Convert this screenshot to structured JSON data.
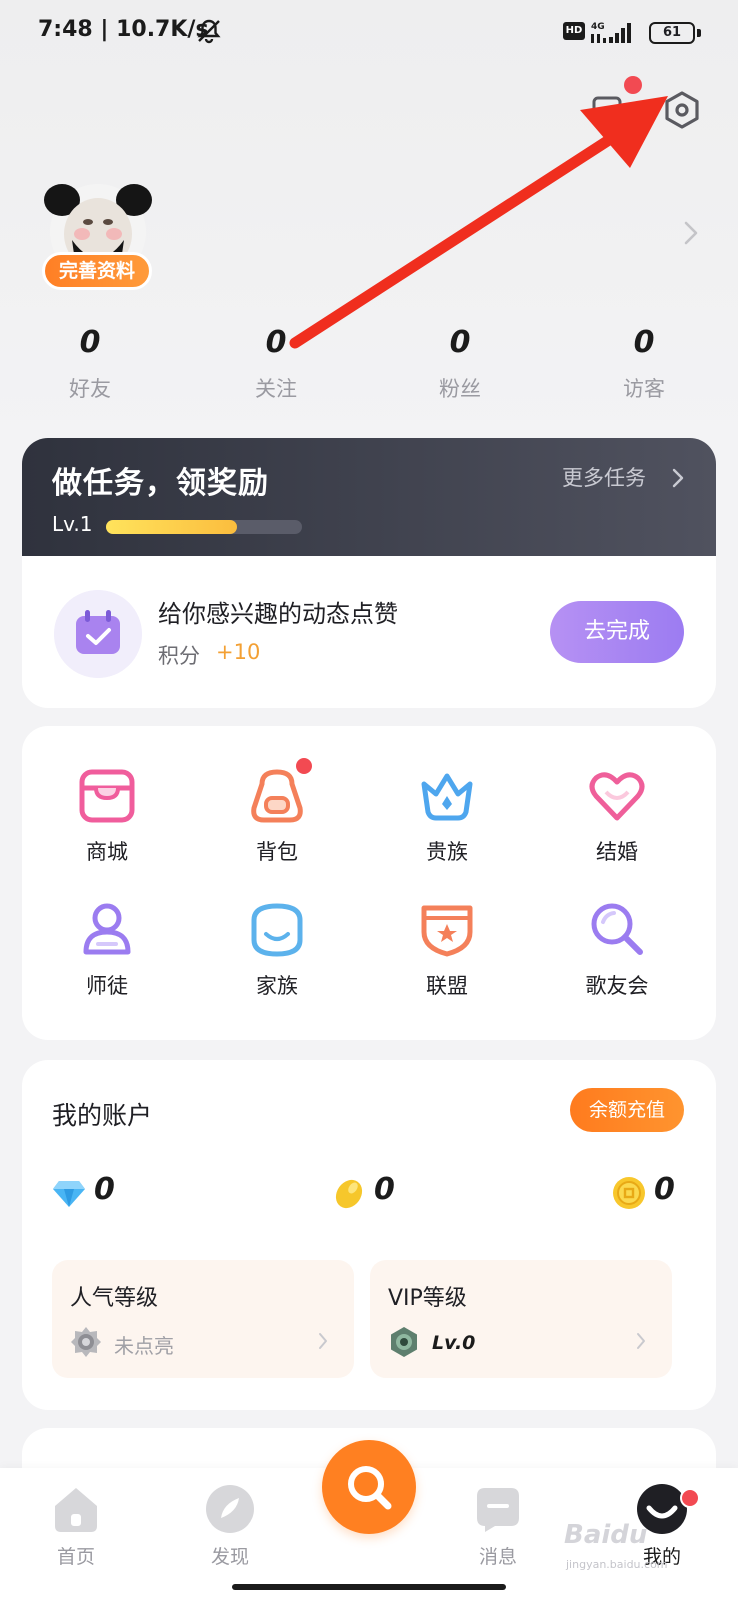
{
  "status_bar": {
    "time_speed": "7:48 | 10.7K/s",
    "hd": "HD",
    "network": "4G",
    "battery": "61"
  },
  "header": {
    "scan_icon": "scan-icon",
    "settings_icon": "settings-icon"
  },
  "profile": {
    "complete_profile": "完善资料",
    "stats": [
      {
        "value": "0",
        "label": "好友"
      },
      {
        "value": "0",
        "label": "关注"
      },
      {
        "value": "0",
        "label": "粉丝"
      },
      {
        "value": "0",
        "label": "访客"
      }
    ]
  },
  "tasks": {
    "title": "做任务，领奖励",
    "more": "更多任务",
    "level": "Lv.1",
    "level_progress": 0.67,
    "item": {
      "title": "给你感兴趣的动态点赞",
      "points_label": "积分",
      "points_value": "+10",
      "action": "去完成"
    }
  },
  "features": [
    {
      "label": "商城",
      "icon": "store-icon"
    },
    {
      "label": "背包",
      "icon": "backpack-icon"
    },
    {
      "label": "贵族",
      "icon": "crown-icon"
    },
    {
      "label": "结婚",
      "icon": "heart-icon"
    },
    {
      "label": "师徒",
      "icon": "mentor-icon"
    },
    {
      "label": "家族",
      "icon": "family-icon"
    },
    {
      "label": "联盟",
      "icon": "alliance-icon"
    },
    {
      "label": "歌友会",
      "icon": "microphone-icon"
    }
  ],
  "account": {
    "title": "我的账户",
    "recharge": "余额充值",
    "balances": [
      {
        "icon": "diamond-icon",
        "value": "0"
      },
      {
        "icon": "bean-icon",
        "value": "0"
      },
      {
        "icon": "coin-icon",
        "value": "0"
      }
    ],
    "popularity": {
      "title": "人气等级",
      "value": "未点亮"
    },
    "vip": {
      "title": "VIP等级",
      "value": "Lv.0"
    }
  },
  "bottom_nav": {
    "items": [
      {
        "label": "首页",
        "icon": "home-icon"
      },
      {
        "label": "发现",
        "icon": "discover-icon"
      },
      {
        "label": "",
        "icon": "sing-icon"
      },
      {
        "label": "消息",
        "icon": "message-icon"
      },
      {
        "label": "我的",
        "icon": "me-icon"
      }
    ]
  },
  "watermark": {
    "main": "Baidu",
    "sub": "jingyan.baidu.com"
  },
  "colors": {
    "accent_orange": "#ff8021",
    "purple": "#9c7cf2",
    "badge_red": "#f24a52",
    "task_header": "#2f323d"
  }
}
